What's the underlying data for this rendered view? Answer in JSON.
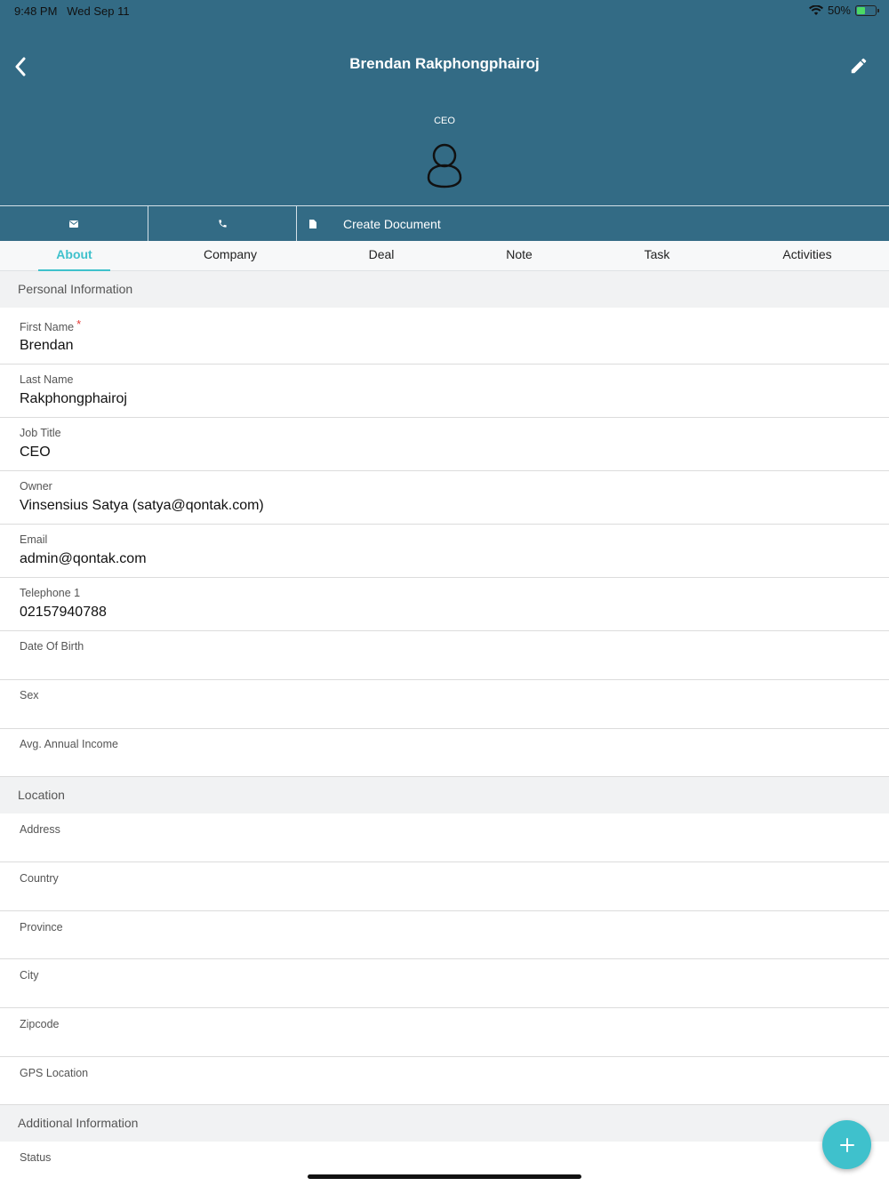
{
  "status_bar": {
    "time": "9:48 PM",
    "date": "Wed Sep 11",
    "battery": "50%",
    "battery_level": 0.5
  },
  "header": {
    "title": "Brendan Rakphongphairoj",
    "subtitle": "CEO",
    "back_icon": "chevron-left-icon",
    "edit_icon": "pencil-icon",
    "avatar_icon": "person-outline-icon"
  },
  "actions": {
    "email_icon": "envelope-icon",
    "phone_icon": "phone-icon",
    "document_icon": "document-icon",
    "create_document_label": "Create Document"
  },
  "tabs": [
    {
      "label": "About",
      "active": true
    },
    {
      "label": "Company"
    },
    {
      "label": "Deal"
    },
    {
      "label": "Note"
    },
    {
      "label": "Task"
    },
    {
      "label": "Activities"
    }
  ],
  "sections": {
    "personal": "Personal Information",
    "location": "Location",
    "additional": "Additional Information"
  },
  "personal_fields": [
    {
      "label": "First Name",
      "value": "Brendan",
      "required_mark": "*"
    },
    {
      "label": "Last Name",
      "value": "Rakphongphairoj"
    },
    {
      "label": "Job Title",
      "value": "CEO"
    },
    {
      "label": "Owner",
      "value": "Vinsensius Satya (satya@qontak.com)"
    },
    {
      "label": "Email",
      "value": "admin@qontak.com"
    },
    {
      "label": "Telephone 1",
      "value": "02157940788"
    },
    {
      "label": "Date Of Birth",
      "value": ""
    },
    {
      "label": "Sex",
      "value": ""
    },
    {
      "label": "Avg. Annual Income",
      "value": ""
    }
  ],
  "location_fields": [
    {
      "label": "Address",
      "value": ""
    },
    {
      "label": "Country",
      "value": ""
    },
    {
      "label": "Province",
      "value": ""
    },
    {
      "label": "City",
      "value": ""
    },
    {
      "label": "Zipcode",
      "value": ""
    },
    {
      "label": "GPS Location",
      "value": ""
    }
  ],
  "additional_fields": [
    {
      "label": "Status",
      "value": ""
    }
  ],
  "fab": {
    "icon": "plus-icon"
  },
  "colors": {
    "header": "#336b85",
    "accent": "#3fc1cc",
    "required": "#e53935",
    "section_bg": "#f1f2f3"
  }
}
